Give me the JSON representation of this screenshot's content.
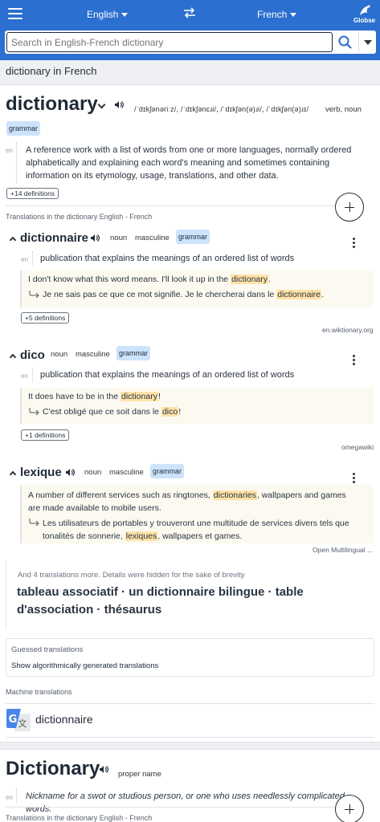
{
  "header": {
    "source_lang": "English",
    "target_lang": "French",
    "logo_text": "Globse",
    "search_placeholder": "Search in English-French dictionary",
    "colors": {
      "brand": "#2b6fd0"
    }
  },
  "page_heading": "dictionary in French",
  "entry": {
    "headword": "dictionary",
    "pronunciation": "/ˈdɪkʃənəriːz/, /ˈdɪkʃənɛɹi/, /ˈdɪkʃən(ə)ɹi/, /ˈdɪkʃən(ə)ɹɪ/",
    "pos": "verb, noun",
    "badge": "grammar",
    "def_lang": "en",
    "definition": "A reference work with a list of words from one or more languages, normally ordered alphabetically and explaining each word's meaning and sometimes containing information on its etymology, usage, translations, and other data.",
    "more_definitions": "+14 definitions",
    "translations_label": "Translations in the dictionary English - French"
  },
  "translations": [
    {
      "word": "dictionnaire",
      "pos": "noun",
      "gender": "masculine",
      "badge": "grammar",
      "def_lang": "en",
      "definition": "publication that explains the meanings of an ordered list of words",
      "ex_en_pre": "I don't know what this word means. I'll look it up in the ",
      "ex_en_hl": "dictionary",
      "ex_en_post": ".",
      "ex_fr_pre": "Je ne sais pas ce que ce mot signifie. Je le chercherai dans le ",
      "ex_fr_hl": "dictionnaire",
      "ex_fr_post": ".",
      "more": "+5 definitions",
      "source": "en.wiktionary.org"
    },
    {
      "word": "dico",
      "pos": "noun",
      "gender": "masculine",
      "badge": "grammar",
      "def_lang": "en",
      "definition": "publication that explains the meanings of an ordered list of words",
      "ex_en_pre": "It does have to be in the ",
      "ex_en_hl": "dictionary",
      "ex_en_post": "!",
      "ex_fr_pre": "C'est obligé que ce soit dans le ",
      "ex_fr_hl": "dico",
      "ex_fr_post": "!",
      "more": "+1 definitions",
      "source": "omegawiki"
    },
    {
      "word": "lexique",
      "pos": "noun",
      "gender": "masculine",
      "badge": "grammar",
      "ex_en_line1_pre": "A number of different services such as ringtones, ",
      "ex_en_hl": "dictionaries",
      "ex_en_line1_post": ", wallpapers and games",
      "ex_en_line2": "are made available to mobile users.",
      "ex_fr_line1": "Les utilisateurs de portables y trouveront une multitude de services divers tels que",
      "ex_fr_line2_pre": "tonalités de sonnerie, ",
      "ex_fr_hl": "lexiques",
      "ex_fr_line2_post": ", wallpapers et games.",
      "source": "Open Multilingual ..."
    }
  ],
  "hidden": {
    "note": "And 4 translations more. Details were hidden for the sake of brevity",
    "line1": "tableau associatif · un dictionnaire bilingue · table",
    "line2": "d'association · thésaurus"
  },
  "guessed": {
    "title": "Guessed translations",
    "link": "Show algorithmically generated translations"
  },
  "machine": {
    "label": "Machine translations",
    "result": "dictionnaire"
  },
  "entry2": {
    "headword": "Dictionary",
    "pos": "proper name",
    "def_lang": "en",
    "definition": "Nickname for a swot or studious person, or one who uses needlessly complicated words.",
    "translations_label": "Translations in the dictionary English - French"
  }
}
